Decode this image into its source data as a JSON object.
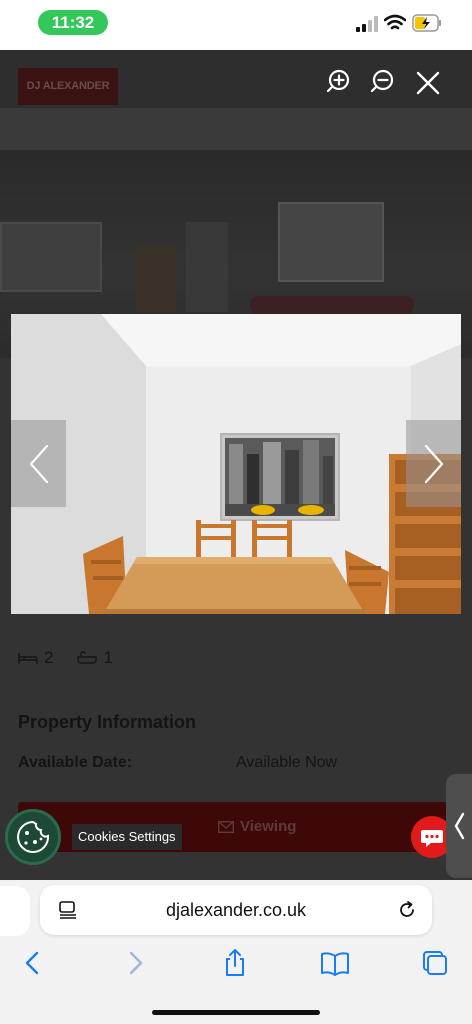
{
  "status_bar": {
    "time": "11:32"
  },
  "site": {
    "logo_text": "DJ ALEXANDER",
    "beds": "2",
    "baths": "1",
    "section_title": "Property Information",
    "available_label": "Available Date:",
    "available_value": "Available Now",
    "viewing_label": "Viewing"
  },
  "cookies": {
    "tooltip": "Cookies Settings"
  },
  "browser": {
    "url": "djalexander.co.uk"
  },
  "icons": {
    "zoom_in": "zoom-in-icon",
    "zoom_out": "zoom-out-icon",
    "close": "close-icon",
    "prev": "chevron-left-icon",
    "next": "chevron-right-icon",
    "cookie": "cookie-icon",
    "chat": "chat-icon"
  },
  "colors": {
    "accent_red": "#e11a1a",
    "cookie_green": "#1d4a35",
    "status_green": "#34c759"
  }
}
